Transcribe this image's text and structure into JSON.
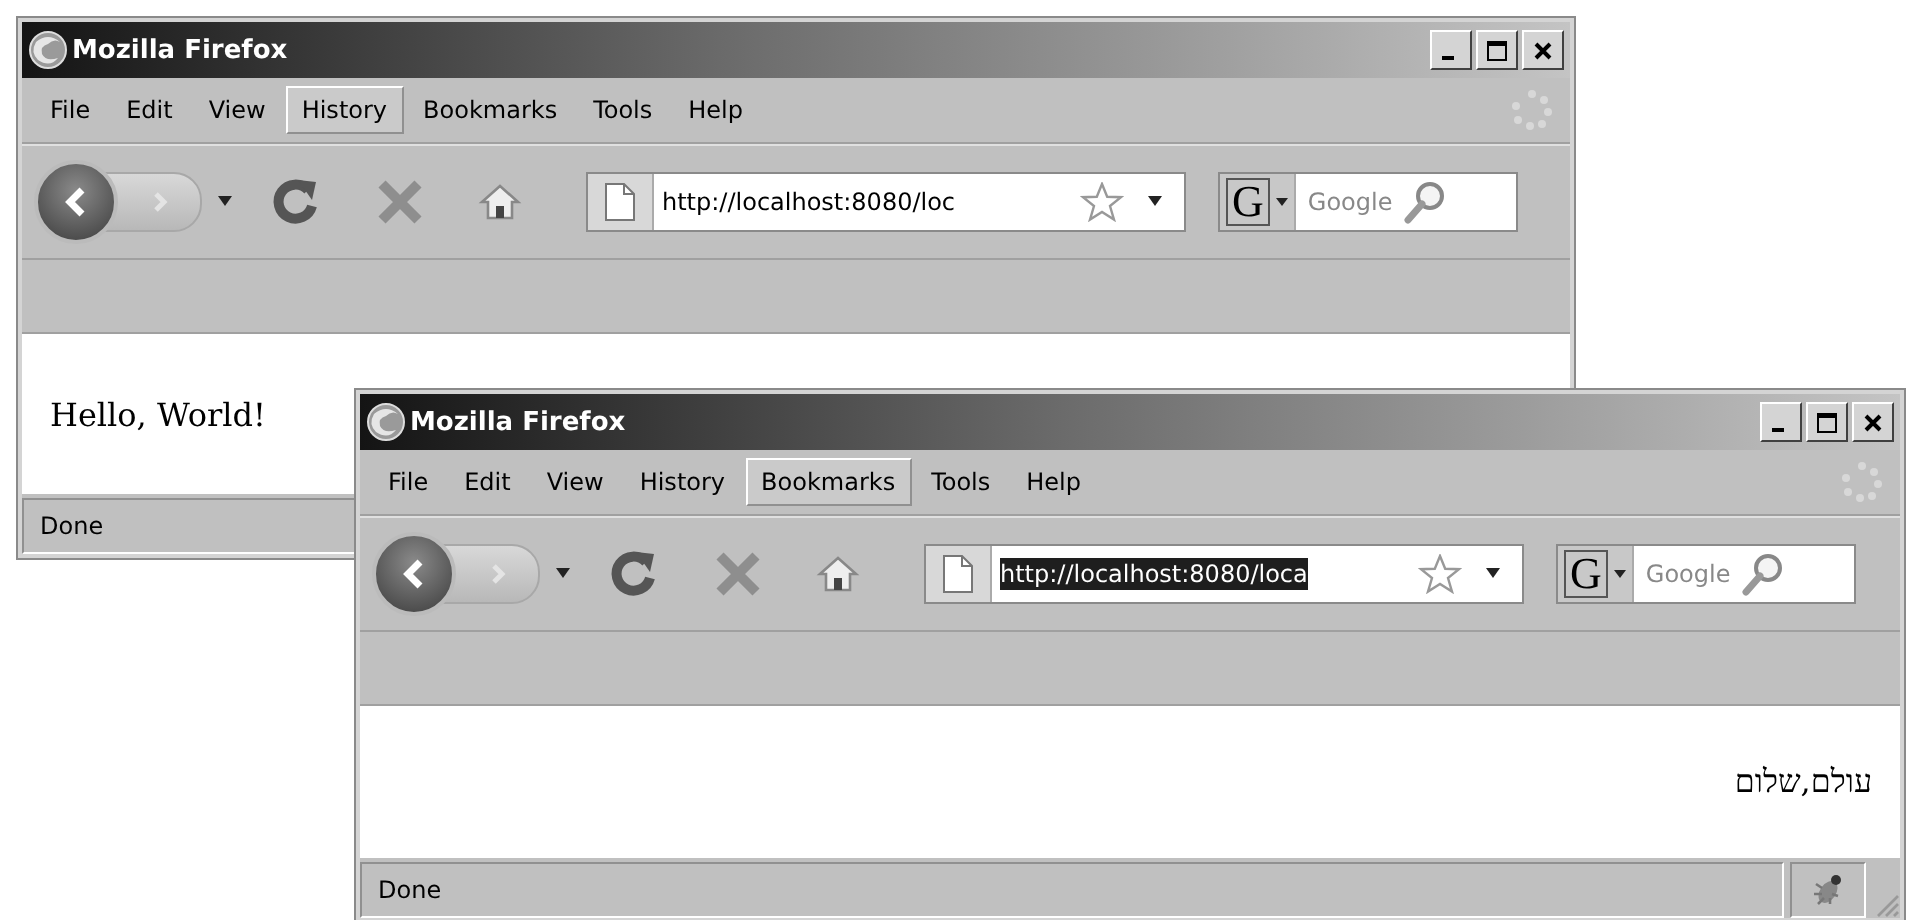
{
  "windows": [
    {
      "title": "Mozilla Firefox",
      "menu": [
        {
          "label": "File",
          "selected": false
        },
        {
          "label": "Edit",
          "selected": false
        },
        {
          "label": "View",
          "selected": false
        },
        {
          "label": "History",
          "selected": true
        },
        {
          "label": "Bookmarks",
          "selected": false
        },
        {
          "label": "Tools",
          "selected": false
        },
        {
          "label": "Help",
          "selected": false
        }
      ],
      "address": {
        "value": "http://localhost:8080/loc",
        "selected": false
      },
      "search": {
        "engine": "G",
        "placeholder": "Google"
      },
      "content": {
        "text": "Hello, World!",
        "rtl": false
      },
      "status": "Done"
    },
    {
      "title": "Mozilla Firefox",
      "menu": [
        {
          "label": "File",
          "selected": false
        },
        {
          "label": "Edit",
          "selected": false
        },
        {
          "label": "View",
          "selected": false
        },
        {
          "label": "History",
          "selected": false
        },
        {
          "label": "Bookmarks",
          "selected": true
        },
        {
          "label": "Tools",
          "selected": false
        },
        {
          "label": "Help",
          "selected": false
        }
      ],
      "address": {
        "value": "http://localhost:8080/loca",
        "selected": true
      },
      "search": {
        "engine": "G",
        "placeholder": "Google"
      },
      "content": {
        "text": "עולם,שלום",
        "rtl": true
      },
      "status": "Done"
    }
  ]
}
